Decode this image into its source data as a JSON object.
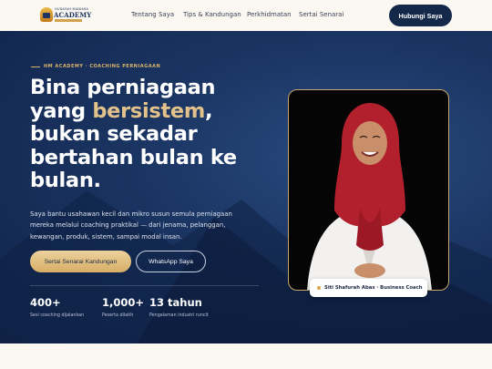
{
  "nav": {
    "logo": {
      "tagline": "HUDAYAH MANIARA",
      "word": "ACADEMY"
    },
    "links": [
      "Tentang Saya",
      "Tips & Kandungan",
      "Perkhidmatan",
      "Sertai Senarai"
    ],
    "cta_label": "Hubungi Saya"
  },
  "hero": {
    "eyebrow": "HM ACADEMY · COACHING PERNIAGAAN",
    "headline": {
      "line1": "Bina perniagaan",
      "line2_prefix": "yang ",
      "line2_highlight": "bersistem",
      "line2_suffix": ",",
      "line3": "bukan sekadar",
      "line4": "bertahan bulan ke",
      "line5": "bulan."
    },
    "lede": "Saya bantu usahawan kecil dan mikro susun semula perniagaan mereka melalui coaching praktikal — dari jenama, pelanggan, kewangan, produk, sistem, sampai modal insan.",
    "primary_button": "Sertai Senarai Kandungan",
    "secondary_button": "WhatsApp Saya",
    "stats": [
      {
        "value": "400+",
        "label": "Sesi coaching dijalankan"
      },
      {
        "value": "1,000+",
        "label": "Peserta dilatih"
      },
      {
        "value": "13 tahun",
        "label": "Pengalaman industri runcit"
      }
    ],
    "photo_caption": "Siti Shafurah Abas · Business Coach"
  },
  "colors": {
    "navy": "#14284a",
    "gold": "#d9b46a",
    "highlight": "#e3c18b",
    "cream": "#fbf8f2"
  }
}
